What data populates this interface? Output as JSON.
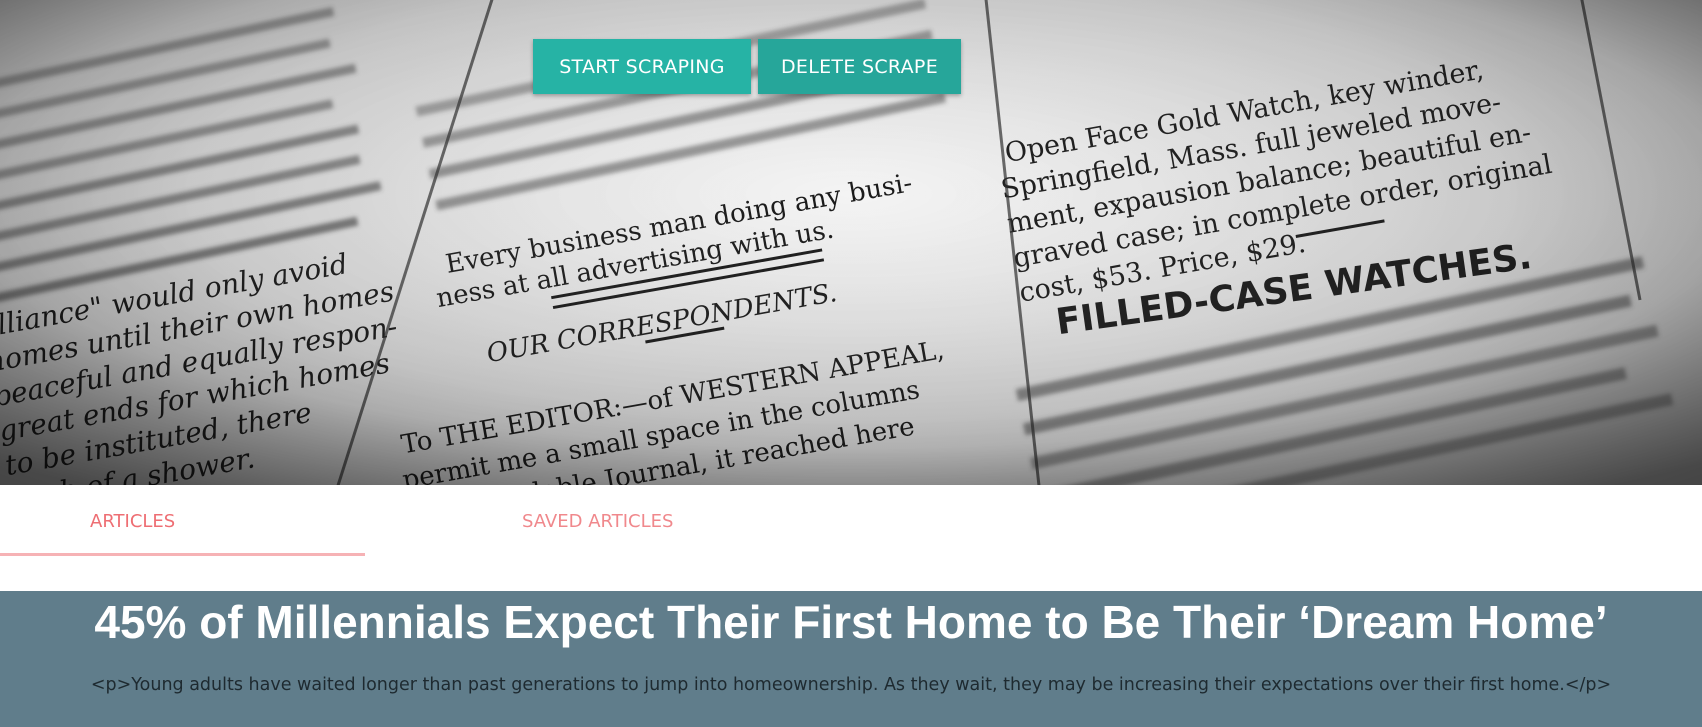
{
  "hero": {
    "image": "newspaper-background-image",
    "start_button": "START SCRAPING",
    "delete_button": "DELETE SCRAPE"
  },
  "tabs": {
    "articles": "ARTICLES",
    "saved": "SAVED ARTICLES"
  },
  "article": {
    "title": "45% of Millennials Expect Their First Home to Be Their ‘Dream Home’",
    "summary": "<p>Young adults have waited longer than past generations to jump into homeownership. As they wait, they may be increasing their expectations over their first home.</p>"
  },
  "colors": {
    "button_teal": "#26a69a",
    "tab_accent": "#ee6e73",
    "article_bg": "#607d8b"
  }
}
